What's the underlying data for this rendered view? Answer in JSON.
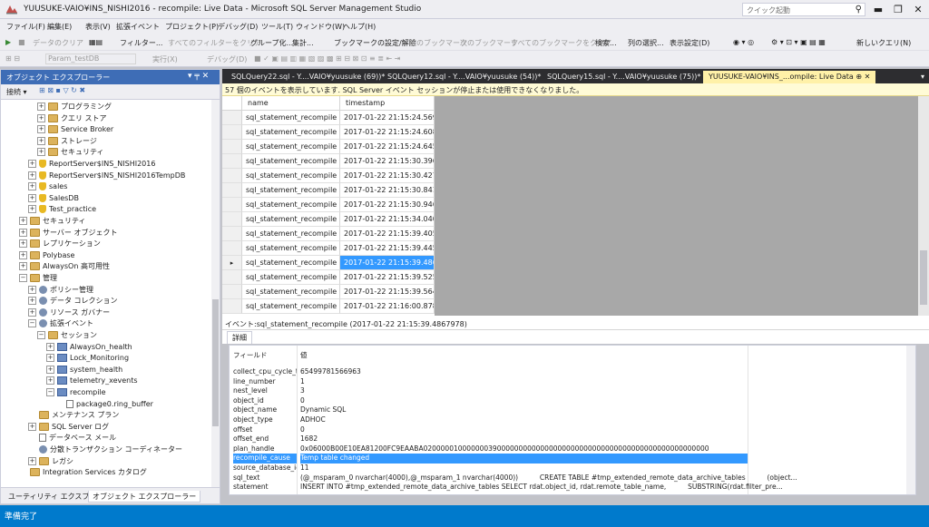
{
  "window": {
    "title": "YUUSUKE-VAIO¥INS_NISHI2016 - recompile: Live Data - Microsoft SQL Server Management Studio",
    "quick_launch_placeholder": "クイック起動",
    "minimize": "▬",
    "restore": "❐",
    "close": "✕"
  },
  "menu": [
    "ファイル(F)",
    "編集(E)",
    "表示(V)",
    "拡張イベント",
    "プロジェクト(P)",
    "デバッグ(D)",
    "ツール(T)",
    "ウィンドウ(W)",
    "ヘルプ(H)"
  ],
  "toolbar1": {
    "data_clear": "データのクリア",
    "filter": "フィルター...",
    "clear_all_filters": "すべてのフィルターをクリア",
    "group": "グループ化...",
    "aggregate": "集計...",
    "bookmark_toggle": "ブックマークの設定/解除",
    "prev_bookmark": "前のブックマーク",
    "next_bookmark": "次のブックマーク",
    "clear_bookmarks": "すべてのブックマークをクリア",
    "search": "検索...",
    "choose_columns": "列の選択...",
    "display_settings": "表示設定(D)",
    "new_query": "新しいクエリ(N)"
  },
  "toolbar2": {
    "db_combo": "Param_testDB",
    "execute": "実行(X)",
    "debug": "デバッグ(D)"
  },
  "object_explorer": {
    "title": "オブジェクト エクスプローラー",
    "pin": "▾ ╤ ✕",
    "connect": "接続 ▾",
    "tree": [
      {
        "label": "プログラミング",
        "indent": 3,
        "icon": "folder",
        "exp": "+"
      },
      {
        "label": "クエリ ストア",
        "indent": 3,
        "icon": "folder",
        "exp": "+"
      },
      {
        "label": "Service Broker",
        "indent": 3,
        "icon": "folder",
        "exp": "+"
      },
      {
        "label": "ストレージ",
        "indent": 3,
        "icon": "folder",
        "exp": "+"
      },
      {
        "label": "セキュリティ",
        "indent": 3,
        "icon": "folder",
        "exp": "+"
      },
      {
        "label": "ReportServer$INS_NISHI2016",
        "indent": 2,
        "icon": "database",
        "exp": "+"
      },
      {
        "label": "ReportServer$INS_NISHI2016TempDB",
        "indent": 2,
        "icon": "database",
        "exp": "+"
      },
      {
        "label": "sales",
        "indent": 2,
        "icon": "database",
        "exp": "+"
      },
      {
        "label": "SalesDB",
        "indent": 2,
        "icon": "database",
        "exp": "+"
      },
      {
        "label": "Test_practice",
        "indent": 2,
        "icon": "database",
        "exp": "+"
      },
      {
        "label": "セキュリティ",
        "indent": 1,
        "icon": "folder",
        "exp": "+"
      },
      {
        "label": "サーバー オブジェクト",
        "indent": 1,
        "icon": "folder",
        "exp": "+"
      },
      {
        "label": "レプリケーション",
        "indent": 1,
        "icon": "folder",
        "exp": "+"
      },
      {
        "label": "Polybase",
        "indent": 1,
        "icon": "folder",
        "exp": "+"
      },
      {
        "label": "AlwaysOn 高可用性",
        "indent": 1,
        "icon": "folder",
        "exp": "+"
      },
      {
        "label": "管理",
        "indent": 1,
        "icon": "folder",
        "exp": "−"
      },
      {
        "label": "ポリシー管理",
        "indent": 2,
        "icon": "gear",
        "exp": "+"
      },
      {
        "label": "データ コレクション",
        "indent": 2,
        "icon": "gear",
        "exp": "+"
      },
      {
        "label": "リソース ガバナー",
        "indent": 2,
        "icon": "gear",
        "exp": "+"
      },
      {
        "label": "拡張イベント",
        "indent": 2,
        "icon": "gear",
        "exp": "−"
      },
      {
        "label": "セッション",
        "indent": 3,
        "icon": "folder",
        "exp": "−"
      },
      {
        "label": "AlwaysOn_health",
        "indent": 4,
        "icon": "session",
        "exp": "+"
      },
      {
        "label": "Lock_Monitoring",
        "indent": 4,
        "icon": "session",
        "exp": "+"
      },
      {
        "label": "system_health",
        "indent": 4,
        "icon": "session",
        "exp": "+"
      },
      {
        "label": "telemetry_xevents",
        "indent": 4,
        "icon": "session",
        "exp": "+"
      },
      {
        "label": "recompile",
        "indent": 4,
        "icon": "session",
        "exp": "−"
      },
      {
        "label": "package0.ring_buffer",
        "indent": 5,
        "icon": "doc",
        "exp": ""
      },
      {
        "label": "メンテナンス プラン",
        "indent": 2,
        "icon": "folder",
        "exp": ""
      },
      {
        "label": "SQL Server ログ",
        "indent": 2,
        "icon": "folder",
        "exp": "+"
      },
      {
        "label": "データベース メール",
        "indent": 2,
        "icon": "doc",
        "exp": ""
      },
      {
        "label": "分散トランザクション コーディネーター",
        "indent": 2,
        "icon": "gear",
        "exp": ""
      },
      {
        "label": "レガシ",
        "indent": 2,
        "icon": "folder",
        "exp": "+"
      },
      {
        "label": "Integration Services カタログ",
        "indent": 1,
        "icon": "folder",
        "exp": ""
      }
    ],
    "bottom_tabs": [
      "ユーティリティ エクスプローラー",
      "オブジェクト エクスプローラー"
    ]
  },
  "doc_tabs": [
    {
      "label": "SQLQuery22.sql - Y....VAIO¥yuusuke (69))*",
      "active": false
    },
    {
      "label": "SQLQuery12.sql - Y....VAIO¥yuusuke (54))*",
      "active": false
    },
    {
      "label": "SQLQuery15.sql - Y....VAIO¥yuusuke (75))*",
      "active": false
    },
    {
      "label": "YUUSUKE-VAIO¥INS_...ompile: Live Data  ⊕  ✕",
      "active": true
    }
  ],
  "info_bar": "57 個のイベントを表示しています. SQL Server イベント セッションが停止または使用できなくなりました。",
  "grid": {
    "columns": [
      "name",
      "timestamp"
    ],
    "selected_marker": "▸",
    "rows": [
      [
        "sql_statement_recompile",
        "2017-01-22 21:15:24.5691116"
      ],
      [
        "sql_statement_recompile",
        "2017-01-22 21:15:24.6083766"
      ],
      [
        "sql_statement_recompile",
        "2017-01-22 21:15:24.6459824"
      ],
      [
        "sql_statement_recompile",
        "2017-01-22 21:15:30.3965648"
      ],
      [
        "sql_statement_recompile",
        "2017-01-22 21:15:30.4275651"
      ],
      [
        "sql_statement_recompile",
        "2017-01-22 21:15:30.8419409"
      ],
      [
        "sql_statement_recompile",
        "2017-01-22 21:15:30.9463919"
      ],
      [
        "sql_statement_recompile",
        "2017-01-22 21:15:34.0406223"
      ],
      [
        "sql_statement_recompile",
        "2017-01-22 21:15:39.4055806"
      ],
      [
        "sql_statement_recompile",
        "2017-01-22 21:15:39.4459986"
      ],
      [
        "sql_statement_recompile",
        "2017-01-22 21:15:39.4867978"
      ],
      [
        "sql_statement_recompile",
        "2017-01-22 21:15:39.5251397"
      ],
      [
        "sql_statement_recompile",
        "2017-01-22 21:15:39.5645749"
      ],
      [
        "sql_statement_recompile",
        "2017-01-22 21:16:00.8781045"
      ]
    ],
    "selected_index": 10
  },
  "detail": {
    "header": "イベント:sql_statement_recompile (2017-01-22 21:15:39.4867978)",
    "tab": "詳細",
    "columns": [
      "フィールド",
      "値"
    ],
    "rows": [
      [
        "collect_cpu_cycle_t...",
        "65499781566963"
      ],
      [
        "line_number",
        "1"
      ],
      [
        "nest_level",
        "3"
      ],
      [
        "object_id",
        "0"
      ],
      [
        "object_name",
        "Dynamic SQL"
      ],
      [
        "object_type",
        "ADHOC"
      ],
      [
        "offset",
        "0"
      ],
      [
        "offset_end",
        "1682"
      ],
      [
        "plan_handle",
        "0x06000B00E10EA81200FC9EAABA020000010000000390000000000000000000000000000000000000000000000000"
      ],
      [
        "recompile_cause",
        "Temp table changed"
      ],
      [
        "source_database_id",
        "11"
      ],
      [
        "sql_text",
        "(@_msparam_0 nvarchar(4000),@_msparam_1 nvarchar(4000))          CREATE TABLE #tmp_extended_remote_data_archive_tables          (object..."
      ],
      [
        "statement",
        "INSERT INTO #tmp_extended_remote_data_archive_tables SELECT rdat.object_id, rdat.remote_table_name,          SUBSTRING(rdat.filter_pre..."
      ]
    ],
    "selected_index": 9
  },
  "status": "準備完了"
}
